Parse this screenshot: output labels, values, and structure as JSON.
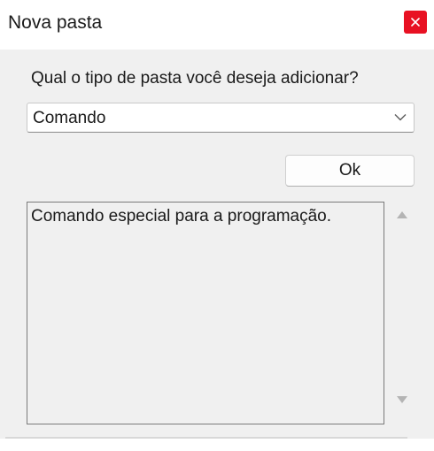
{
  "window": {
    "title": "Nova pasta",
    "close_icon": "close-icon"
  },
  "form": {
    "question": "Qual o tipo de pasta você deseja adicionar?",
    "folder_type": {
      "selected": "Comando",
      "icon": "chevron-down-icon"
    },
    "ok_label": "Ok",
    "description": "Comando especial para a programação."
  },
  "scrollbar": {
    "up_icon": "scroll-up-arrow-icon",
    "down_icon": "scroll-down-arrow-icon"
  },
  "colors": {
    "close_button": "#e81123",
    "client_background": "#f0f0f0",
    "border": "#7a7a7a"
  }
}
